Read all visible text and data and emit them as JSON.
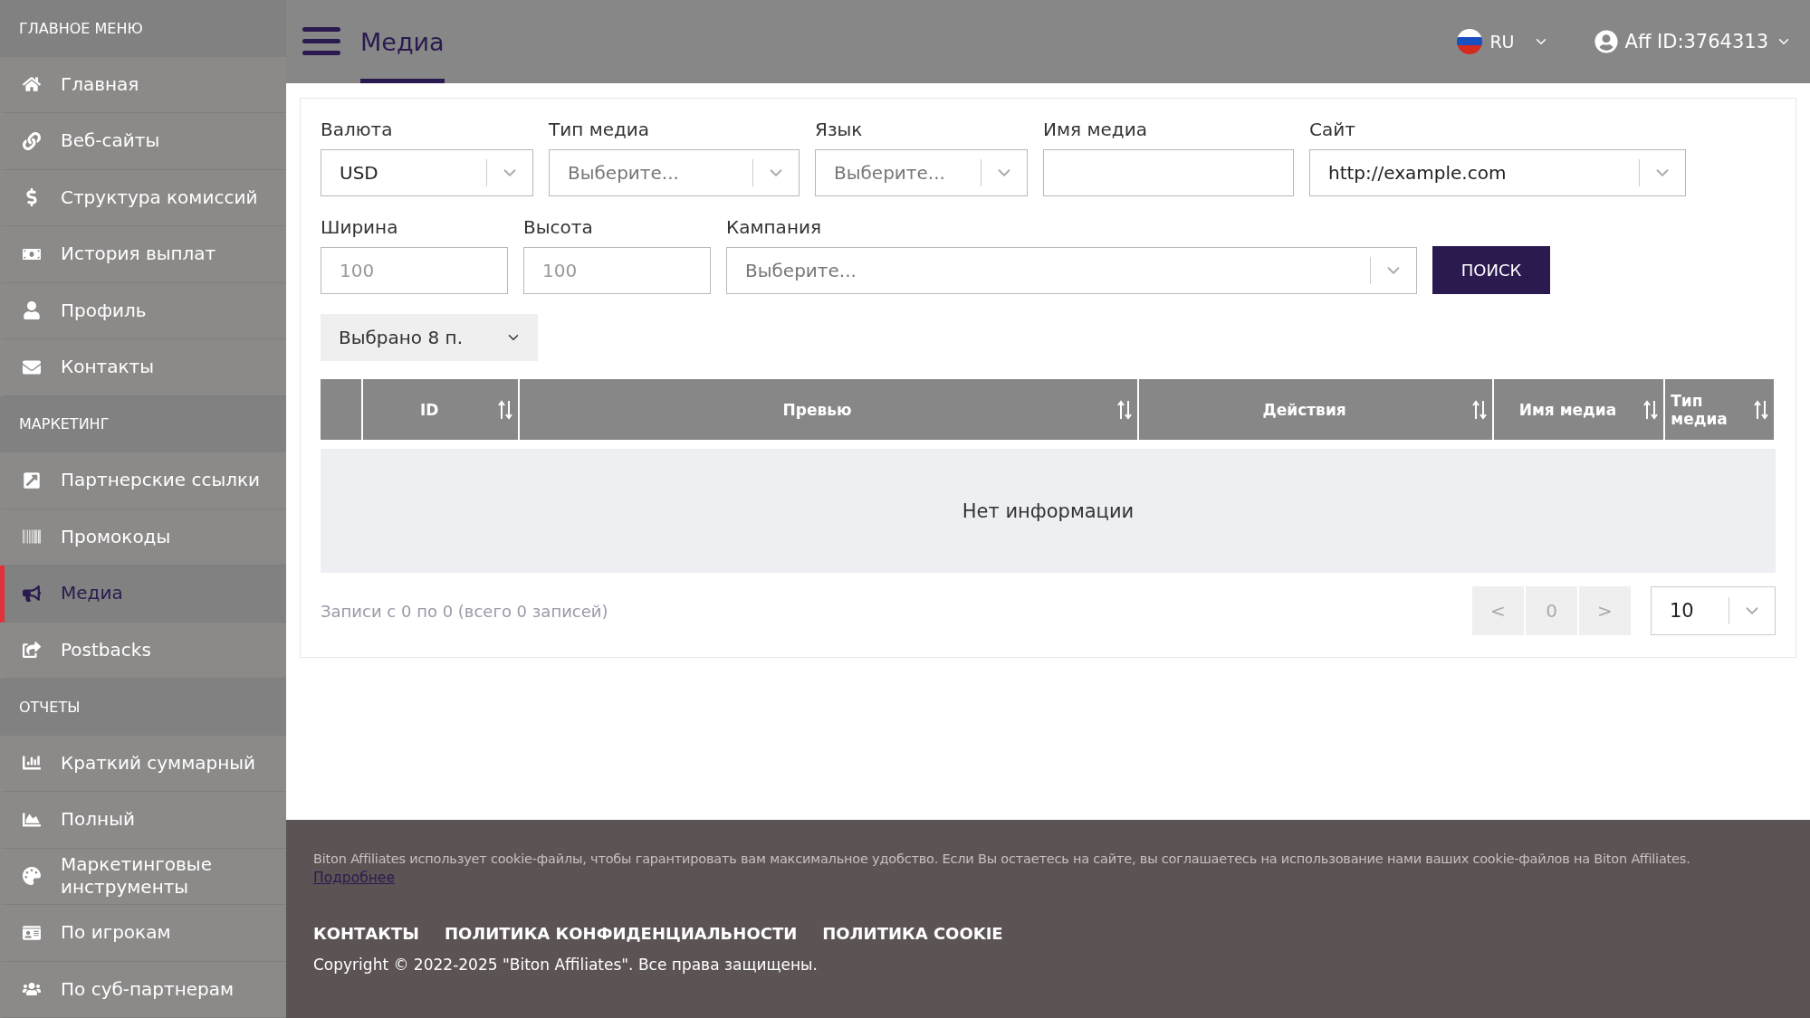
{
  "sidebar": {
    "sections": [
      {
        "title": "ГЛАВНОЕ МЕНЮ",
        "items": [
          {
            "label": "Главная",
            "selected": false
          },
          {
            "label": "Веб-сайты",
            "selected": false
          },
          {
            "label": "Структура комиссий",
            "selected": false
          },
          {
            "label": "История выплат",
            "selected": false
          },
          {
            "label": "Профиль",
            "selected": false
          },
          {
            "label": "Контакты",
            "selected": false
          }
        ]
      },
      {
        "title": "МАРКЕТИНГ",
        "items": [
          {
            "label": "Партнерские ссылки",
            "selected": false
          },
          {
            "label": "Промокоды",
            "selected": false
          },
          {
            "label": "Медиа",
            "selected": true
          },
          {
            "label": "Postbacks",
            "selected": false
          }
        ]
      },
      {
        "title": "ОТЧЕТЫ",
        "items": [
          {
            "label": "Краткий суммарный",
            "selected": false
          },
          {
            "label": "Полный",
            "selected": false
          },
          {
            "label": "Маркетинговые инструменты",
            "selected": false
          },
          {
            "label": "По игрокам",
            "selected": false
          },
          {
            "label": "По суб-партнерам",
            "selected": false
          }
        ]
      }
    ]
  },
  "header": {
    "title": "Медиа",
    "language": "RU",
    "account": "Aff ID:3764313"
  },
  "filters": {
    "rows": [
      {
        "fields": [
          {
            "label": "Валюта",
            "kind": "select",
            "value": "USD"
          },
          {
            "label": "Тип медиа",
            "kind": "select",
            "placeholder": "Выберите..."
          },
          {
            "label": "Язык",
            "kind": "select",
            "placeholder": "Выберите..."
          },
          {
            "label": "Имя медиа",
            "kind": "input"
          },
          {
            "label": "Сайт",
            "kind": "select",
            "value": "http://example.com"
          }
        ]
      },
      {
        "fields": [
          {
            "label": "Ширина",
            "kind": "input",
            "placeholder": "100"
          },
          {
            "label": "Высота",
            "kind": "input",
            "placeholder": "100"
          },
          {
            "label": "Кампания",
            "kind": "select",
            "placeholder": "Выберите..."
          }
        ]
      }
    ],
    "search_button": "ПОИСК",
    "column_selector": "Выбрано 8 п."
  },
  "table": {
    "columns": [
      "ID",
      "Превью",
      "Действия",
      "Имя медиа",
      "Тип медиа"
    ],
    "empty_message": "Нет информации"
  },
  "pagination": {
    "info": "Записи с 0 по 0 (всего 0 записей)",
    "prev": "<",
    "page": "0",
    "next": ">",
    "page_size": "10"
  },
  "footer": {
    "cookie_text": "Biton Affiliates использует cookie-файлы, чтобы гарантировать вам максимальное удобство. Если Вы остаетесь на сайте, вы соглашаетесь на использование нами ваших cookie-файлов на Biton Affiliates.",
    "more_link": "Подробнее",
    "links": [
      "КОНТАКТЫ",
      "ПОЛИТИКА КОНФИДЕНЦИАЛЬНОСТИ",
      "ПОЛИТИКА COOKIE"
    ],
    "copyright": "Copyright © 2022-2025 \"Biton Affiliates\". Все права защищены."
  }
}
